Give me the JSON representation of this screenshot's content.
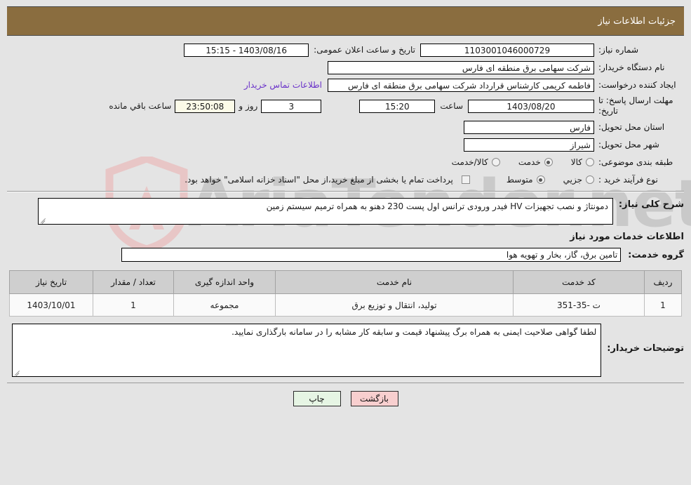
{
  "header": {
    "title": "جزئیات اطلاعات نیاز"
  },
  "form": {
    "need_number_label": "شماره نیاز:",
    "need_number_value": "1103001046000729",
    "announce_datetime_label": "تاریخ و ساعت اعلان عمومی:",
    "announce_datetime_value": "1403/08/16 - 15:15",
    "buyer_org_label": "نام دستگاه خریدار:",
    "buyer_org_value": "شرکت سهامی برق منطقه ای فارس",
    "requester_label": "ایجاد کننده درخواست:",
    "requester_value": "فاطمه کریمی کارشناس قرارداد شرکت سهامی برق منطقه ای فارس",
    "contact_link_label": "اطلاعات تماس خریدار",
    "deadline_label_line1": "مهلت ارسال پاسخ: تا",
    "deadline_label_line2": "تاریخ:",
    "deadline_date_value": "1403/08/20",
    "deadline_time_label": "ساعت",
    "deadline_time_value": "15:20",
    "remaining_days_value": "3",
    "remaining_days_label": "روز و",
    "remaining_clock_value": "23:50:08",
    "remaining_clock_label": "ساعت باقي مانده",
    "province_label": "استان محل تحویل:",
    "province_value": "فارس",
    "city_label": "شهر محل تحویل:",
    "city_value": "شیراز",
    "category_label": "طبقه بندی موضوعی:",
    "category_options": [
      {
        "label": "کالا",
        "selected": false
      },
      {
        "label": "خدمت",
        "selected": true
      },
      {
        "label": "کالا/خدمت",
        "selected": false
      }
    ],
    "process_type_label": "نوع فرآیند خرید :",
    "process_type_options": [
      {
        "label": "جزیي",
        "selected": false
      },
      {
        "label": "متوسط",
        "selected": true
      }
    ],
    "treasury_checked": false,
    "treasury_note": "پرداخت تمام یا بخشی از مبلغ خرید،از محل \"اسناد خزانه اسلامی\" خواهد بود."
  },
  "need_description": {
    "label": "شرح کلی نیاز:",
    "value": "دمونتاژ و نصب تجهیزات HV فیدر ورودی ترانس اول پست 230 دهنو به همراه ترمیم سیستم زمین"
  },
  "services_section": {
    "heading": "اطلاعات خدمات مورد نیاز",
    "group_label": "گروه خدمت:",
    "group_value": "تامین برق، گاز، بخار و تهویه هوا",
    "table": {
      "columns": [
        "ردیف",
        "کد خدمت",
        "نام خدمت",
        "واحد اندازه گیری",
        "تعداد / مقدار",
        "تاریخ نیاز"
      ],
      "rows": [
        {
          "radif": "1",
          "code": "ت -35-351",
          "name": "تولید، انتقال و توزیع برق",
          "unit": "مجموعه",
          "quantity": "1",
          "need_date": "1403/10/01"
        }
      ]
    }
  },
  "buyer_notes": {
    "label": "توضیحات خریدار:",
    "value": "لطفا گواهی صلاحیت ایمنی به همراه برگ پیشنهاد قیمت و سابقه کار مشابه را در سامانه بارگذاری نمایید."
  },
  "footer": {
    "print_label": "چاپ",
    "back_label": "بازگشت"
  },
  "watermark": {
    "text": "AriaTender.net"
  },
  "colors": {
    "header_bg": "#8a6d3f",
    "page_bg": "#e4e4e4",
    "link": "#6a32c9",
    "countdown_bg": "#fcfbe8",
    "table_header_bg": "#cfcfcf",
    "print_btn_bg": "#e6f5e4",
    "back_btn_bg": "#f8cfcf"
  }
}
